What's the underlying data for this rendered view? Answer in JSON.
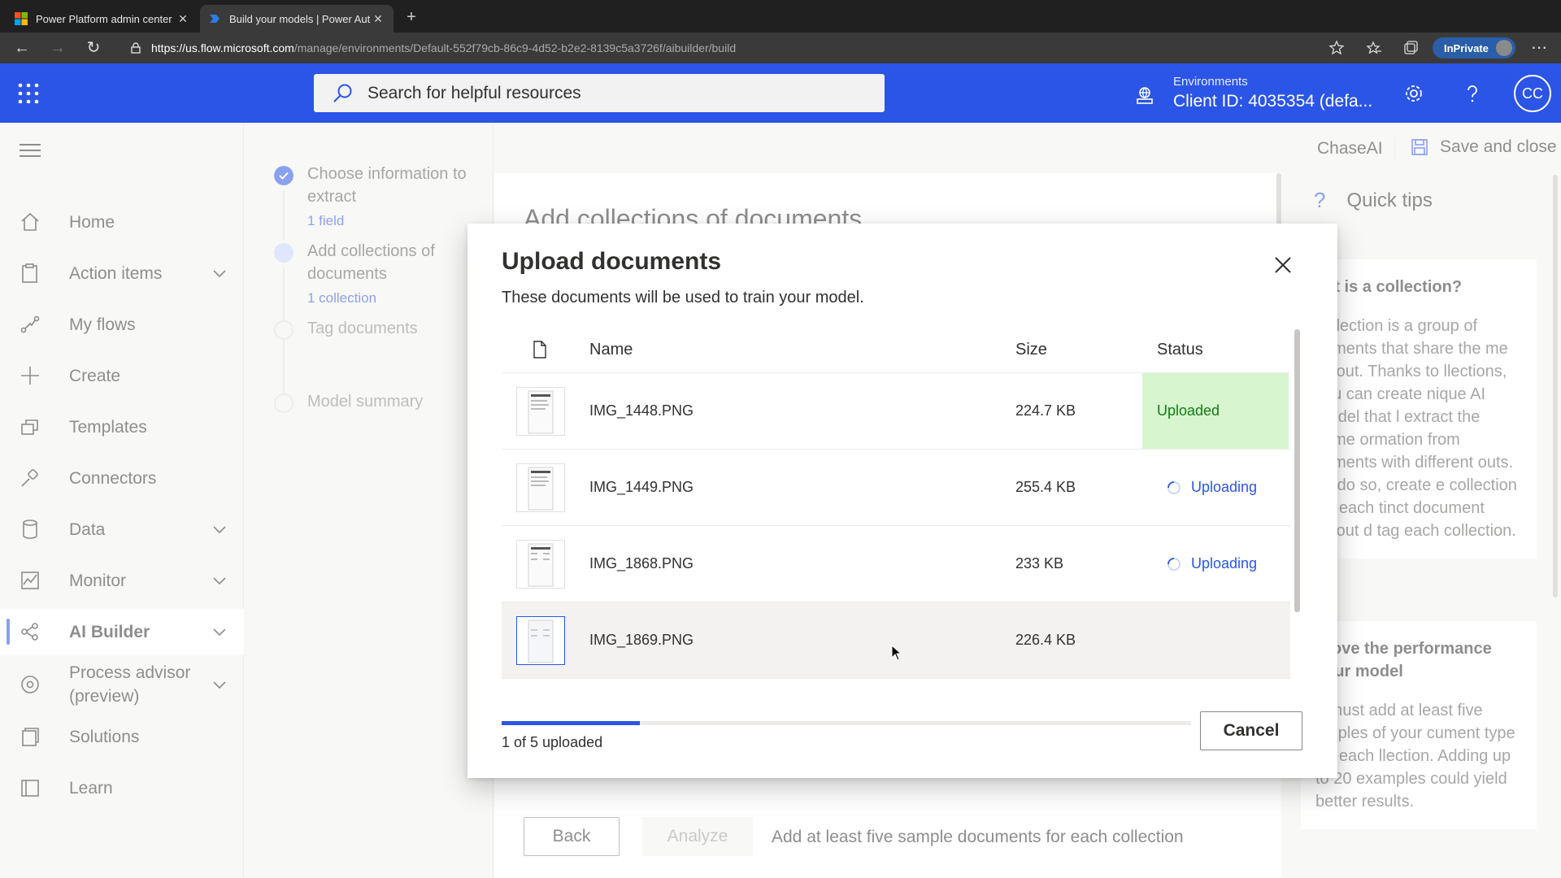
{
  "browser": {
    "tabs": [
      {
        "title": "Power Platform admin center",
        "icon": "microsoft-logo-icon"
      },
      {
        "title": "Build your models | Power Aut",
        "icon": "power-automate-icon"
      }
    ],
    "url_host": "https://us.flow.microsoft.com",
    "url_path": "/manage/environments/Default-552f79cb-86c9-4d52-b2e2-8139c5a3726f/aibuilder/build",
    "inprivate": "InPrivate"
  },
  "header": {
    "search_placeholder": "Search for helpful resources",
    "env_label": "Environments",
    "env_value": "Client ID: 4035354 (defa...",
    "avatar_initials": "CC",
    "accent": "#2b55e6"
  },
  "nav": {
    "items": [
      {
        "label": "Home",
        "icon": "home-icon"
      },
      {
        "label": "Action items",
        "icon": "clipboard-icon"
      },
      {
        "label": "My flows",
        "icon": "flow-icon"
      },
      {
        "label": "Create",
        "icon": "plus-icon"
      },
      {
        "label": "Templates",
        "icon": "templates-icon"
      },
      {
        "label": "Connectors",
        "icon": "connector-icon"
      },
      {
        "label": "Data",
        "icon": "database-icon"
      },
      {
        "label": "Monitor",
        "icon": "monitor-icon"
      },
      {
        "label": "AI Builder",
        "icon": "ai-builder-icon"
      },
      {
        "label": "Process advisor (preview)",
        "icon": "process-advisor-icon"
      },
      {
        "label": "Solutions",
        "icon": "solutions-icon"
      },
      {
        "label": "Learn",
        "icon": "book-icon"
      }
    ]
  },
  "wizard": {
    "steps": [
      {
        "title": "Choose information to extract",
        "sub": "1 field",
        "state": "done"
      },
      {
        "title": "Add collections of documents",
        "sub": "1 collection",
        "state": "current"
      },
      {
        "title": "Tag documents",
        "sub": "",
        "state": "pending"
      },
      {
        "title": "Model summary",
        "sub": "",
        "state": "pending"
      }
    ]
  },
  "main": {
    "title": "Add collections of documents",
    "back_label": "Back",
    "analyze_label": "Analyze",
    "hint": "Add at least five sample documents for each collection"
  },
  "cmdbar": {
    "model_name": "ChaseAI",
    "save_label": "Save and close"
  },
  "tips": {
    "title": "Quick tips",
    "cards": [
      {
        "heading": "hat is a collection?",
        "body": "collection is a group of cuments that share the me layout. Thanks to llections, you can create nique AI model that l extract the same ormation from cuments with different outs. To do so, create e collection for each tinct document layout d tag each collection."
      },
      {
        "heading": "prove the performance your model",
        "body": "u must add at least five amples of your cument type for each llection. Adding up to 20 examples could yield better results."
      }
    ]
  },
  "dialog": {
    "title": "Upload documents",
    "subtitle": "These documents will be used to train your model.",
    "columns": {
      "name": "Name",
      "size": "Size",
      "status": "Status"
    },
    "rows": [
      {
        "name": "IMG_1448.PNG",
        "size": "224.7 KB",
        "status": "Uploaded"
      },
      {
        "name": "IMG_1449.PNG",
        "size": "255.4 KB",
        "status": "Uploading"
      },
      {
        "name": "IMG_1868.PNG",
        "size": "233 KB",
        "status": "Uploading"
      },
      {
        "name": "IMG_1869.PNG",
        "size": "226.4 KB",
        "status": ""
      }
    ],
    "progress_fraction": 0.2,
    "progress_label": "1 of 5 uploaded",
    "cancel_label": "Cancel"
  }
}
